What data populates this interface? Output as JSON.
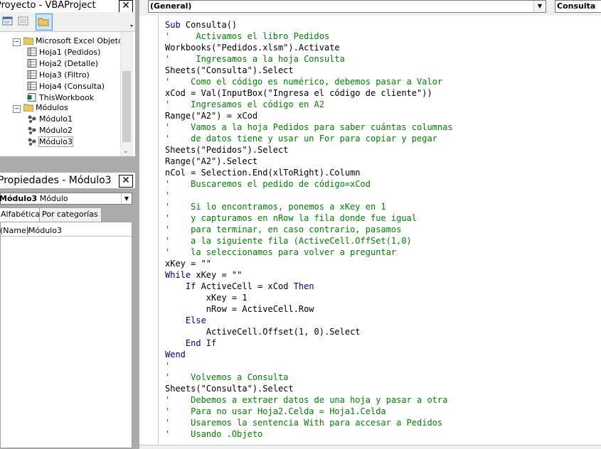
{
  "project": {
    "title": "Proyecto - VBAProject",
    "close": "✕",
    "tree": [
      {
        "label": "Microsoft Excel Objetos",
        "kind": "folder",
        "toggle": "⊟"
      },
      {
        "label": "Hoja1 (Pedidos)",
        "kind": "sheet"
      },
      {
        "label": "Hoja2 (Detalle)",
        "kind": "sheet"
      },
      {
        "label": "Hoja3 (Filtro)",
        "kind": "sheet"
      },
      {
        "label": "Hoja4 (Consulta)",
        "kind": "sheet"
      },
      {
        "label": "ThisWorkbook",
        "kind": "workbook"
      },
      {
        "label": "Módulos",
        "kind": "folder",
        "toggle": "⊟"
      },
      {
        "label": "Módulo1",
        "kind": "module"
      },
      {
        "label": "Módulo2",
        "kind": "module"
      },
      {
        "label": "Módulo3",
        "kind": "module"
      }
    ]
  },
  "properties": {
    "title": "Propiedades - Módulo3",
    "close": "✕",
    "object_name": "Módulo3",
    "object_type": "Módulo",
    "tabs": [
      "Alfabética",
      "Por categorías"
    ],
    "rows": [
      {
        "name": "(Name)",
        "value": "Módulo3"
      }
    ]
  },
  "code": {
    "object_combo": "(General)",
    "proc_combo": "Consulta",
    "lines": [
      [
        [
          "kw",
          "Sub "
        ],
        [
          "tx",
          "Consulta()"
        ]
      ],
      [
        [
          "cm",
          "'     Activamos el libro Pedidos"
        ]
      ],
      [
        [
          "tx",
          "Workbooks(\"Pedidos.xlsm\").Activate"
        ]
      ],
      [
        [
          "cm",
          "'     Ingresamos a la hoja Consulta"
        ]
      ],
      [
        [
          "tx",
          "Sheets(\"Consulta\").Select"
        ]
      ],
      [
        [
          "cm",
          "'    Como el código es numérico, debemos pasar a Valor"
        ]
      ],
      [
        [
          "tx",
          "xCod = Val(InputBox(\"Ingresa el código de cliente\"))"
        ]
      ],
      [
        [
          "cm",
          "'    Ingresamos el código en A2"
        ]
      ],
      [
        [
          "tx",
          "Range(\"A2\") = xCod"
        ]
      ],
      [
        [
          "cm",
          "'    Vamos a la hoja Pedidos para saber cuántas columnas"
        ]
      ],
      [
        [
          "cm",
          "'    de datos tiene y usar un For para copiar y pegar"
        ]
      ],
      [
        [
          "tx",
          "Sheets(\"Pedidos\").Select"
        ]
      ],
      [
        [
          "tx",
          "Range(\"A2\").Select"
        ]
      ],
      [
        [
          "tx",
          "nCol = Selection.End(xlToRight).Column"
        ]
      ],
      [
        [
          "cm",
          "'    Buscaremos el pedido de código=xCod"
        ]
      ],
      [
        [
          "cm",
          "'"
        ]
      ],
      [
        [
          "cm",
          "'    Si lo encontramos, ponemos a xKey en 1"
        ]
      ],
      [
        [
          "cm",
          "'    y capturamos en nRow la fila donde fue igual"
        ]
      ],
      [
        [
          "cm",
          "'    para terminar, en caso contrario, pasamos"
        ]
      ],
      [
        [
          "cm",
          "'    a la siguiente fila (ActiveCell.OffSet(1,0)"
        ]
      ],
      [
        [
          "cm",
          "'    la seleccionamos para volver a preguntar"
        ]
      ],
      [
        [
          "tx",
          "xKey = \"\""
        ]
      ],
      [
        [
          "kw",
          "While "
        ],
        [
          "tx",
          "xKey = \"\""
        ]
      ],
      [
        [
          "tx",
          "    "
        ],
        [
          "kw",
          "If "
        ],
        [
          "tx",
          "ActiveCell = xCod "
        ],
        [
          "kw",
          "Then"
        ]
      ],
      [
        [
          "tx",
          "        xKey = 1"
        ]
      ],
      [
        [
          "tx",
          "        nRow = ActiveCell.Row"
        ]
      ],
      [
        [
          "tx",
          "    "
        ],
        [
          "kw",
          "Else"
        ]
      ],
      [
        [
          "tx",
          "        ActiveCell.Offset(1, 0).Select"
        ]
      ],
      [
        [
          "tx",
          "    "
        ],
        [
          "kw",
          "End If"
        ]
      ],
      [
        [
          "kw",
          "Wend"
        ]
      ],
      [
        [
          "cm",
          "'"
        ]
      ],
      [
        [
          "cm",
          "'    Volvemos a Consulta"
        ]
      ],
      [
        [
          "tx",
          "Sheets(\"Consulta\").Select"
        ]
      ],
      [
        [
          "cm",
          "'    Debemos a extraer datos de una hoja y pasar a otra"
        ]
      ],
      [
        [
          "cm",
          "'    Para no usar Hoja2.Celda = Hoja1.Celda"
        ]
      ],
      [
        [
          "cm",
          "'    Usaremos la sentencia With para accesar a Pedidos"
        ]
      ],
      [
        [
          "cm",
          "'    Usando .Objeto"
        ]
      ]
    ]
  },
  "colors": {
    "keyword": "#00007f",
    "comment": "#007f00",
    "folder": "#e8c860"
  }
}
